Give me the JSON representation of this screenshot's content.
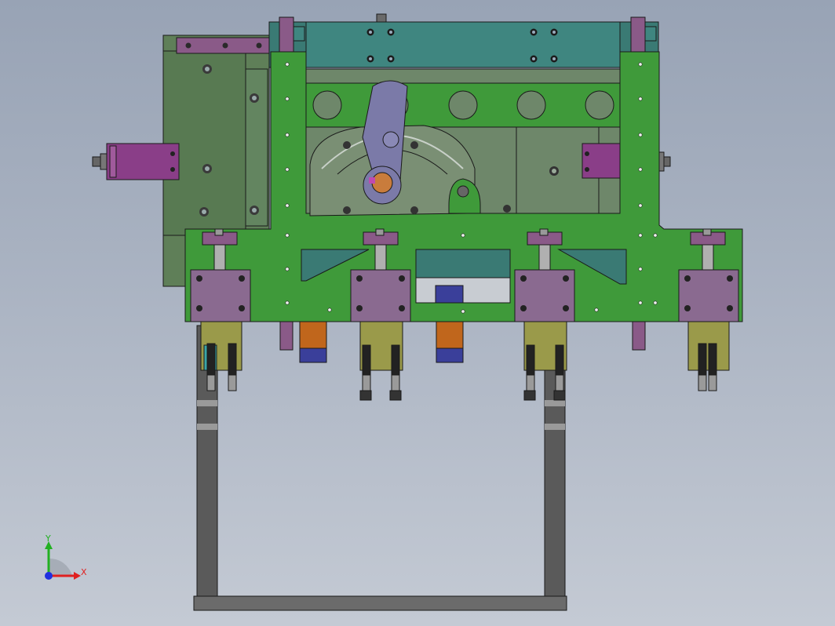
{
  "viewport": {
    "background_top": "#98a3b5",
    "background_bottom": "#c4cad4"
  },
  "triad": {
    "x_label": "X",
    "y_label": "Y",
    "x_color": "#e02020",
    "y_color": "#22b022",
    "z_color": "#2030e0"
  },
  "colors": {
    "main_plate": "#3f9a3a",
    "back_housing": "#5f7f58",
    "teal_block": "#3a7a74",
    "purple_part": "#7d5a86",
    "magenta_cylinder": "#8a3e88",
    "olive_bracket": "#9a9a4a",
    "orange_sensor": "#c0661c",
    "blue_cap": "#3a3f9a",
    "grey_frame": "#5a5a5a",
    "lever_arm": "#7b7aa8"
  }
}
